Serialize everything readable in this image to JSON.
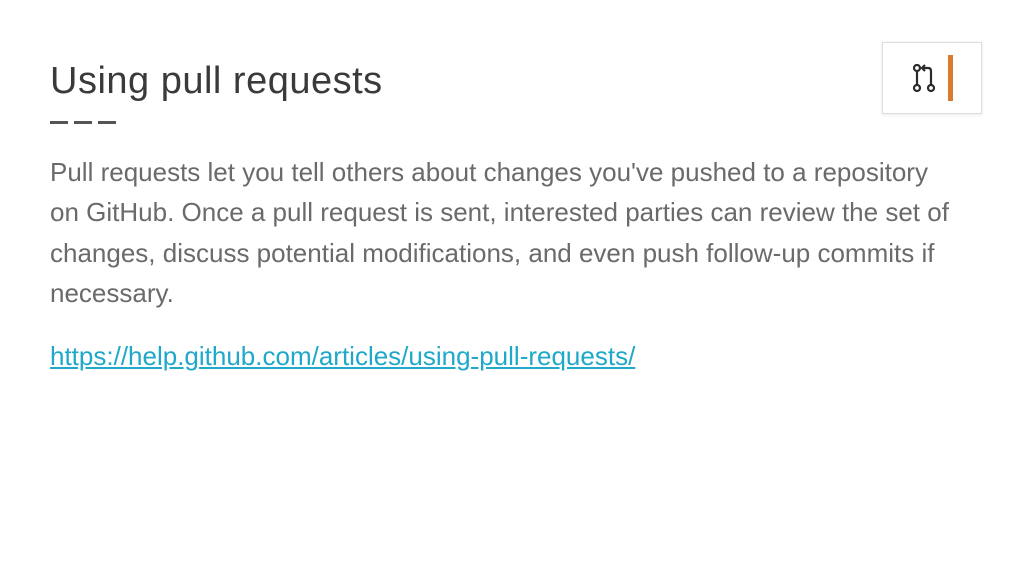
{
  "title": "Using pull requests",
  "body": "Pull requests let you tell others about changes you've pushed to a repository on GitHub. Once a pull request is sent, interested parties can review the set of changes, discuss potential modifications, and even push follow-up commits if necessary.",
  "link": "https://help.github.com/articles/using-pull-requests/",
  "icon_name": "pull-request-icon",
  "colors": {
    "accent_orange": "#d97a2e",
    "link_blue": "#1fa8c9",
    "heading": "#3a3a3a",
    "body_text": "#6a6a6a"
  }
}
